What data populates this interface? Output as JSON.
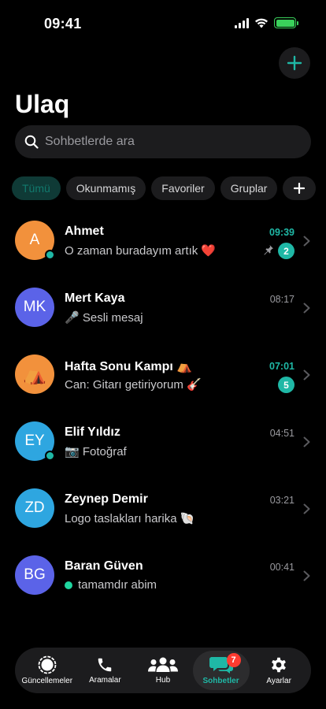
{
  "status_bar": {
    "time": "09:41"
  },
  "header": {
    "title": "Ulaq"
  },
  "search": {
    "placeholder": "Sohbetlerde ara"
  },
  "filters": [
    {
      "label": "Tümü",
      "active": true
    },
    {
      "label": "Okunmamış",
      "active": false
    },
    {
      "label": "Favoriler",
      "active": false
    },
    {
      "label": "Gruplar",
      "active": false
    }
  ],
  "chats": [
    {
      "name": "Ahmet",
      "initials": "A",
      "avatar_color": "#f2913c",
      "online": true,
      "preview": "O zaman buradayım artık ❤️",
      "time": "09:39",
      "unread_count": "2",
      "pinned": true
    },
    {
      "name": "Mert Kaya",
      "initials": "MK",
      "avatar_color": "#5b63e8",
      "online": false,
      "preview": "🎤 Sesli mesaj",
      "time": "08:17",
      "unread_count": "",
      "pinned": false
    },
    {
      "name": "Hafta Sonu Kampı ⛺",
      "initials": "⛺",
      "avatar_color": "#f2913c",
      "online": false,
      "preview": "Can: Gitarı getiriyorum 🎸",
      "time": "07:01",
      "unread_count": "5",
      "pinned": false
    },
    {
      "name": "Elif Yıldız",
      "initials": "EY",
      "avatar_color": "#2ea6e0",
      "online": true,
      "preview": "📷 Fotoğraf",
      "time": "04:51",
      "unread_count": "",
      "pinned": false
    },
    {
      "name": "Zeynep Demir",
      "initials": "ZD",
      "avatar_color": "#2ea6e0",
      "online": false,
      "preview": "Logo taslakları harika 🐚",
      "time": "03:21",
      "unread_count": "",
      "pinned": false
    },
    {
      "name": "Baran Güven",
      "initials": "BG",
      "avatar_color": "#5b63e8",
      "online": false,
      "preview": "tamamdır abim",
      "time": "00:41",
      "unread_count": "",
      "pinned": false,
      "preview_dot": true
    }
  ],
  "tabs": [
    {
      "label": "Güncellemeler",
      "icon": "updates-icon",
      "active": false
    },
    {
      "label": "Aramalar",
      "icon": "phone-icon",
      "active": false
    },
    {
      "label": "Hub",
      "icon": "people-icon",
      "active": false
    },
    {
      "label": "Sohbetler",
      "icon": "chat-icon",
      "active": true,
      "badge": "7"
    },
    {
      "label": "Ayarlar",
      "icon": "gear-icon",
      "active": false
    }
  ],
  "colors": {
    "accent": "#1fb8a6",
    "background": "#000000",
    "surface": "#1c1c1e",
    "badge_red": "#ff3b30"
  }
}
